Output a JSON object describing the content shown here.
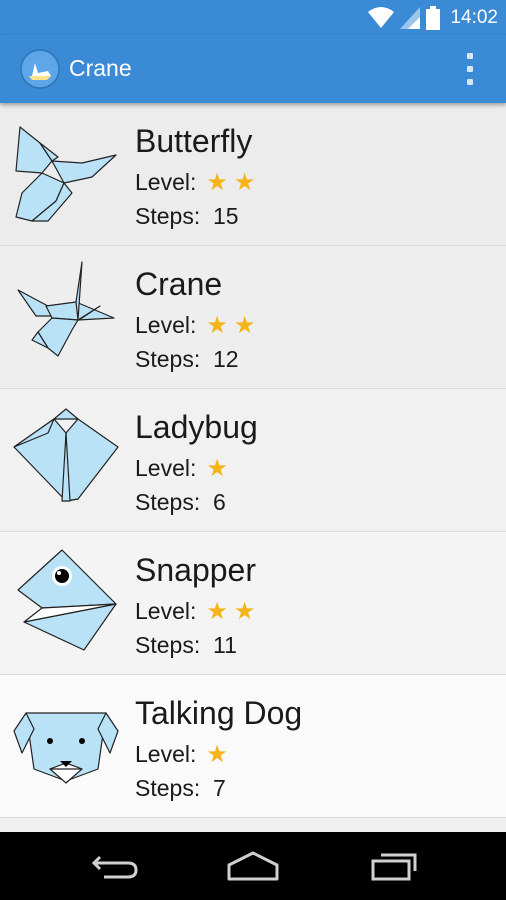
{
  "status": {
    "time": "14:02"
  },
  "header": {
    "title": "Crane"
  },
  "labels": {
    "level": "Level:",
    "steps": "Steps:"
  },
  "items": [
    {
      "name": "Butterfly",
      "stars": "★★",
      "stars_count": 2,
      "steps": "15",
      "icon": "butterfly-origami-icon"
    },
    {
      "name": "Crane",
      "stars": "★★",
      "stars_count": 2,
      "steps": "12",
      "icon": "crane-origami-icon"
    },
    {
      "name": "Ladybug",
      "stars": "★",
      "stars_count": 1,
      "steps": "6",
      "icon": "ladybug-origami-icon"
    },
    {
      "name": "Snapper",
      "stars": "★★",
      "stars_count": 2,
      "steps": "11",
      "icon": "snapper-origami-icon"
    },
    {
      "name": "Talking Dog",
      "stars": "★",
      "stars_count": 1,
      "steps": "7",
      "icon": "dog-origami-icon"
    }
  ],
  "colors": {
    "accent": "#3a8ad6",
    "paper": "#b9e2f7",
    "star": "#f4b41a"
  }
}
